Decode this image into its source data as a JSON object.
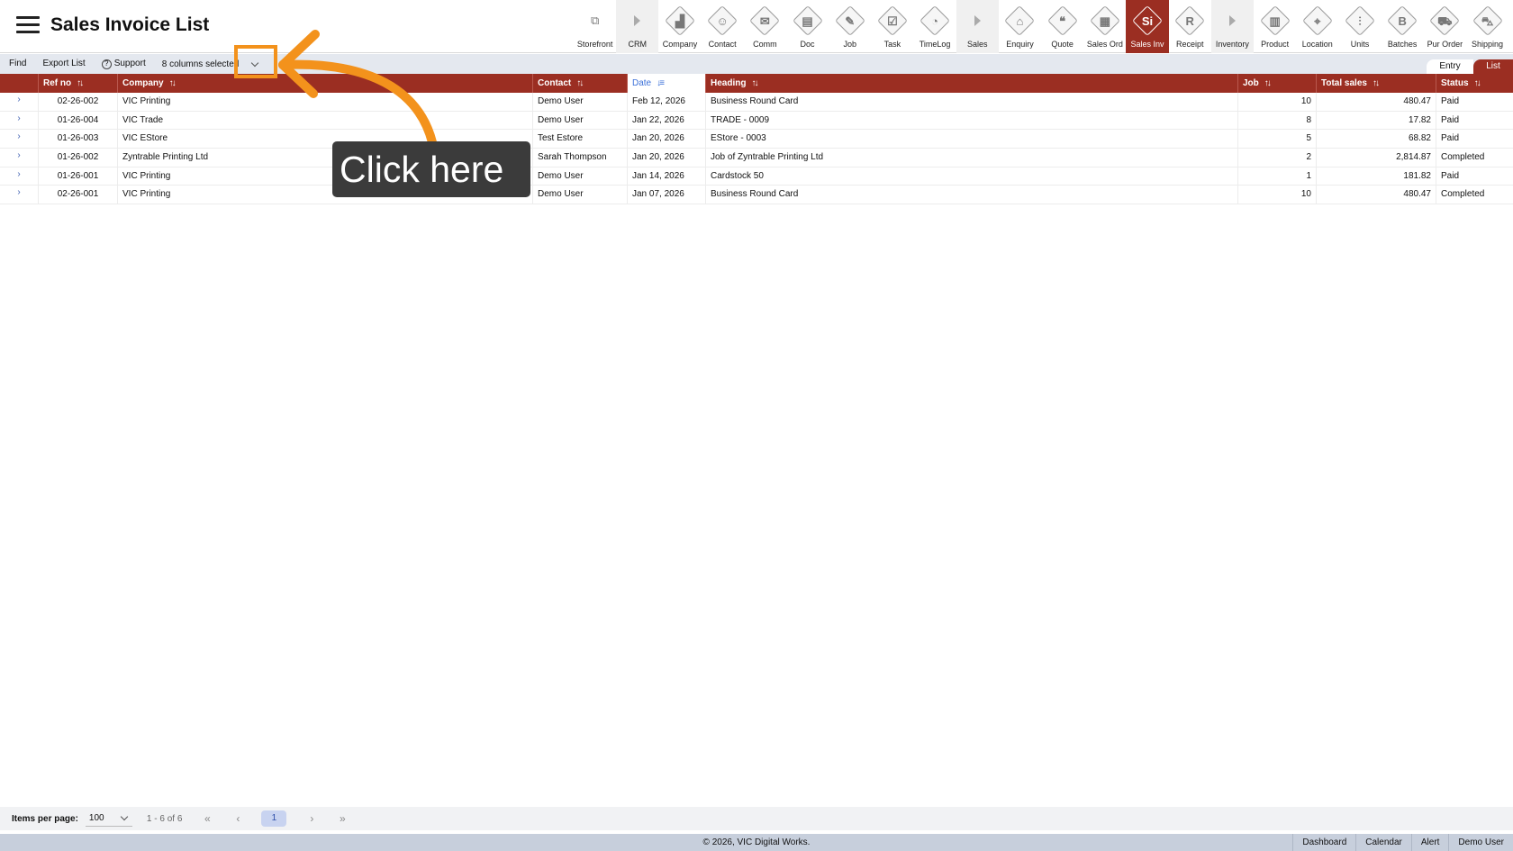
{
  "header": {
    "title": "Sales Invoice List"
  },
  "nav": [
    {
      "label": "Storefront",
      "icon": "external-link-icon",
      "kind": "ext"
    },
    {
      "label": "CRM",
      "icon": "chevron-right-icon",
      "kind": "group"
    },
    {
      "label": "Company",
      "icon": "company-icon",
      "glyph": "▟"
    },
    {
      "label": "Contact",
      "icon": "contact-icon",
      "glyph": "☺"
    },
    {
      "label": "Comm",
      "icon": "comm-icon",
      "glyph": "✉"
    },
    {
      "label": "Doc",
      "icon": "doc-icon",
      "glyph": "▤"
    },
    {
      "label": "Job",
      "icon": "job-icon",
      "glyph": "✎"
    },
    {
      "label": "Task",
      "icon": "task-icon",
      "glyph": "☑"
    },
    {
      "label": "TimeLog",
      "icon": "clock-icon",
      "glyph": "◔"
    },
    {
      "label": "Sales",
      "icon": "chevron-right-icon",
      "kind": "group"
    },
    {
      "label": "Enquiry",
      "icon": "enquiry-icon",
      "glyph": "⌂"
    },
    {
      "label": "Quote",
      "icon": "quote-icon",
      "glyph": "❝"
    },
    {
      "label": "Sales Ord",
      "icon": "sales-order-icon",
      "glyph": "▦"
    },
    {
      "label": "Sales Inv",
      "icon": "sales-invoice-icon",
      "glyph": "Si",
      "active": true
    },
    {
      "label": "Receipt",
      "icon": "receipt-icon",
      "glyph": "R"
    },
    {
      "label": "Inventory",
      "icon": "chevron-right-icon",
      "kind": "group"
    },
    {
      "label": "Product",
      "icon": "product-icon",
      "glyph": "▥"
    },
    {
      "label": "Location",
      "icon": "location-icon",
      "glyph": "⌖"
    },
    {
      "label": "Units",
      "icon": "units-icon",
      "glyph": "⫶"
    },
    {
      "label": "Batches",
      "icon": "batches-icon",
      "glyph": "B"
    },
    {
      "label": "Pur Order",
      "icon": "cart-icon",
      "glyph": "⛟"
    },
    {
      "label": "Shipping",
      "icon": "shipping-icon",
      "glyph": "⛍"
    }
  ],
  "toolbar": {
    "find": "Find",
    "export": "Export List",
    "support": "Support",
    "columns": "8 columns selected"
  },
  "view_toggle": {
    "entry": "Entry",
    "list": "List"
  },
  "table": {
    "columns": [
      "Ref no",
      "Company",
      "Contact",
      "Date",
      "Heading",
      "Job",
      "Total sales",
      "Status"
    ],
    "sorted_column": "Date",
    "rows": [
      {
        "ref": "02-26-002",
        "company": "VIC Printing",
        "contact": "Demo User",
        "date": "Feb 12, 2026",
        "heading": "Business Round Card",
        "job": "10",
        "total": "480.47",
        "status": "Paid"
      },
      {
        "ref": "01-26-004",
        "company": "VIC Trade",
        "contact": "Demo User",
        "date": "Jan 22, 2026",
        "heading": "TRADE - 0009",
        "job": "8",
        "total": "17.82",
        "status": "Paid"
      },
      {
        "ref": "01-26-003",
        "company": "VIC EStore",
        "contact": "Test Estore",
        "date": "Jan 20, 2026",
        "heading": "EStore - 0003",
        "job": "5",
        "total": "68.82",
        "status": "Paid"
      },
      {
        "ref": "01-26-002",
        "company": "Zyntrable Printing Ltd",
        "contact": "Sarah Thompson",
        "date": "Jan 20, 2026",
        "heading": "Job of Zyntrable Printing Ltd",
        "job": "2",
        "total": "2,814.87",
        "status": "Completed"
      },
      {
        "ref": "01-26-001",
        "company": "VIC Printing",
        "contact": "Demo User",
        "date": "Jan 14, 2026",
        "heading": "Cardstock 50",
        "job": "1",
        "total": "181.82",
        "status": "Paid"
      },
      {
        "ref": "02-26-001",
        "company": "VIC Printing",
        "contact": "Demo User",
        "date": "Jan 07, 2026",
        "heading": "Business Round Card",
        "job": "10",
        "total": "480.47",
        "status": "Completed"
      }
    ]
  },
  "overlay": {
    "tooltip": "Click here",
    "accent": "#f3921c"
  },
  "pagination": {
    "label": "Items per page:",
    "per_page": "100",
    "range": "1 - 6 of 6",
    "current_page": "1"
  },
  "footer": {
    "copyright": "© 2026, VIC Digital Works.",
    "links": [
      "Dashboard",
      "Calendar",
      "Alert",
      "Demo User"
    ]
  },
  "colors": {
    "brand": "#9b2e22",
    "toolbar": "#e4e8ef",
    "footer": "#c7cfdc",
    "sorted": "#3a6fd8"
  }
}
